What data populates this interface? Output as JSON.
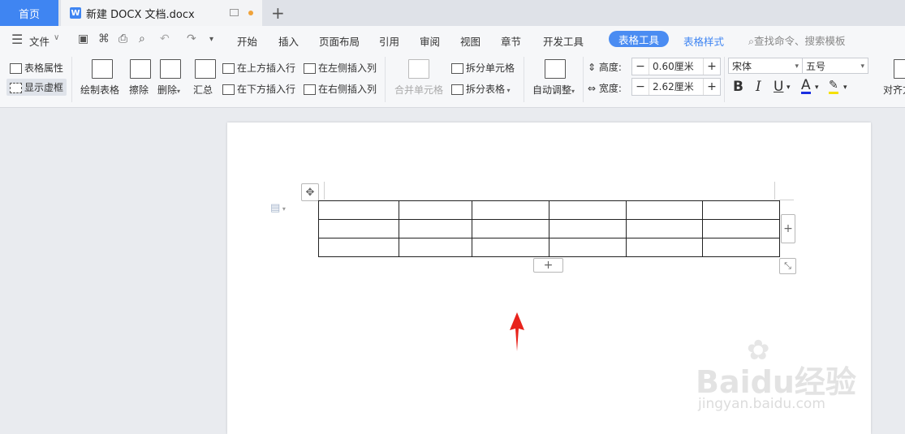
{
  "tabs": {
    "home": "首页",
    "doc_icon": "W",
    "doc_title": "新建 DOCX 文档.docx",
    "new_tab": "+"
  },
  "menu": {
    "file": "文件",
    "items": [
      "开始",
      "插入",
      "页面布局",
      "引用",
      "审阅",
      "视图",
      "章节",
      "开发工具"
    ],
    "active": "表格工具",
    "table_style": "表格样式",
    "search": "查找命令、搜索模板"
  },
  "ribbon": {
    "table_props": "表格属性",
    "show_grid": "显示虚框",
    "draw_table": "绘制表格",
    "erase": "擦除",
    "delete": "删除",
    "summary": "汇总",
    "insert_above": "在上方插入行",
    "insert_below": "在下方插入行",
    "insert_left": "在左侧插入列",
    "insert_right": "在右侧插入列",
    "merge_cells": "合并单元格",
    "split_cells": "拆分单元格",
    "split_table": "拆分表格",
    "auto_adjust": "自动调整",
    "height_label": "高度:",
    "height_value": "0.60厘米",
    "width_label": "宽度:",
    "width_value": "2.62厘米",
    "font": "宋体",
    "font_size": "五号",
    "bold": "B",
    "italic": "I",
    "underline": "U",
    "font_color": "A",
    "align": "对齐方"
  },
  "table": {
    "rows": 3,
    "cols": 6
  },
  "watermark": {
    "brand": "Baidu经验",
    "url": "jingyan.baidu.com"
  },
  "colors": {
    "accent": "#3f85f2",
    "arrow": "#e8231c"
  }
}
